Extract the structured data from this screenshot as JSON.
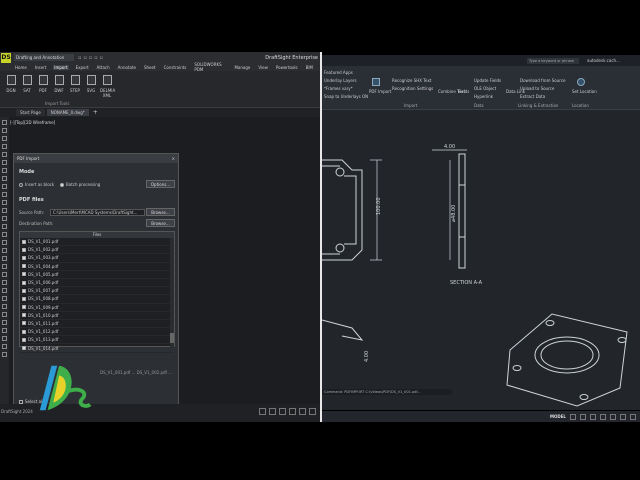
{
  "left_app": {
    "title": "DraftSight Enterprise",
    "workspace": "Drafting and Annotation",
    "tabs": [
      "Home",
      "Insert",
      "Import",
      "Export",
      "Attach",
      "Annotate",
      "Sheet",
      "Constraints",
      "SOLIDWORKS PDM",
      "Manage",
      "View",
      "Powertools",
      "BIM"
    ],
    "active_tab": "Import",
    "ribbon_buttons": [
      "DGN",
      "SAT",
      "PDF",
      "DWF",
      "STEP",
      "SVG",
      "DELMIA XML"
    ],
    "ribbon_group": "Import Tools",
    "doc_tabs": [
      "Start Page",
      "NONAME_0.dwg*"
    ],
    "view_label": "[-][Top][2D Wireframe]",
    "command_line": "DS_V1_001.pdf ... DS_V1_002.pdf ...",
    "statusbar_brand": "DraftSight 2024"
  },
  "dialog": {
    "title": "PDF Import",
    "close": "×",
    "mode_heading": "Mode",
    "insert_as_block": "Insert as block",
    "batch_processing": "Batch processing",
    "options_button": "Options...",
    "pdf_files_heading": "PDF files",
    "source_path_label": "Source Path:",
    "source_path_value": "C:\\Users\\Mert\\MCAD Systems\\DraftSight...",
    "destination_path_label": "Destination Path:",
    "browse": "Browse...",
    "files_header": "Files",
    "files": [
      "DS_V1_001.pdf",
      "DS_V1_002.pdf",
      "DS_V1_003.pdf",
      "DS_V1_004.pdf",
      "DS_V1_005.pdf",
      "DS_V1_006.pdf",
      "DS_V1_007.pdf",
      "DS_V1_008.pdf",
      "DS_V1_009.pdf",
      "DS_V1_010.pdf",
      "DS_V1_011.pdf",
      "DS_V1_012.pdf",
      "DS_V1_013.pdf",
      "DS_V1_014.pdf"
    ],
    "select_all": "Select all",
    "ok": "OK",
    "cancel": "Cancel",
    "help": "Help"
  },
  "right_app": {
    "search_placeholder": "Type a keyword or phrase",
    "user": "autodesk.cach...",
    "ribbon_items": [
      "Featured Apps",
      "Underlay Layers",
      "*Frames vary*",
      "Snap to Underlays ON",
      "PDF Import",
      "Recognize SHX Text",
      "Recognition Settings",
      "Combine Text",
      "Fields",
      "Update Fields",
      "OLE Object",
      "Hyperlink",
      "Data Link",
      "Download from Source",
      "Upload to Source",
      "Extract Data",
      "Set Location"
    ],
    "ribbon_groups": [
      "Import",
      "Data",
      "Linking & Extraction",
      "Location"
    ],
    "dim_top": "4.00",
    "dim_height": "100.00",
    "dim_dia": "⌀48.00",
    "section_label": "SECTION A-A",
    "dim_lower": "4.00",
    "command_line": "Command: PDFIMPORT C:\\Videos\\PDF\\DS_V1_001.pdf...",
    "model_label": "MODEL"
  },
  "colors": {
    "accent": "#c9d42b",
    "drawing": "#cfd4d8",
    "background": "#22262b"
  }
}
